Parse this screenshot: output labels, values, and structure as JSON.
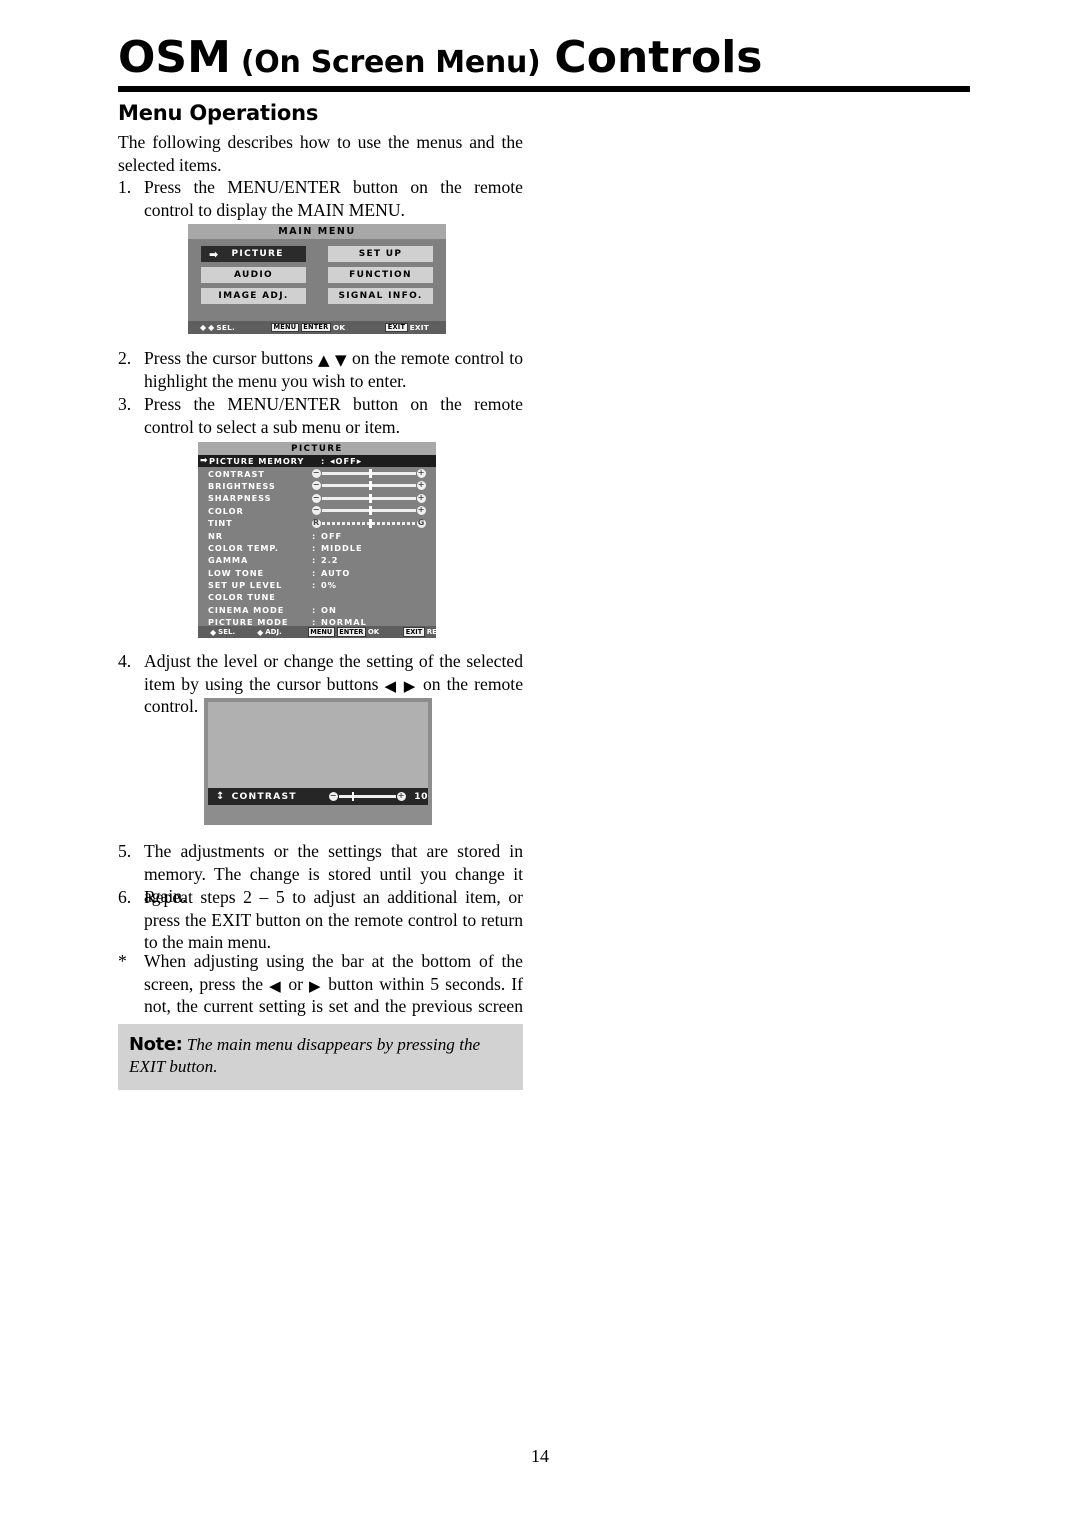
{
  "header": {
    "title_part1": "OSM",
    "title_part2": "(On Screen Menu)",
    "title_part3": "Controls",
    "section_title": "Menu Operations"
  },
  "intro": "The following describes how to use the menus and the selected items.",
  "steps": [
    {
      "marker": "1.",
      "text": "Press the MENU/ENTER button on the remote control to display the MAIN MENU."
    },
    {
      "marker": "2.",
      "text_a": "Press the cursor buttons",
      "icon_up": "▲",
      "icon_down": "▼",
      "text_b": "on the remote control to highlight the menu you wish to enter."
    },
    {
      "marker": "3.",
      "text": "Press the MENU/ENTER button on the remote control to select a sub menu or item."
    },
    {
      "marker": "4.",
      "text_a": "Adjust the level or change the setting of the selected item by using the cursor buttons",
      "icon_left": "◀",
      "icon_right": "▶",
      "text_b": "on the remote control."
    },
    {
      "marker": "5.",
      "text": "The adjustments or the settings that are stored in memory. The change is stored until you change it again."
    },
    {
      "marker": "6.",
      "text": "Repeat steps 2 – 5 to adjust an additional item, or press the EXIT button on the remote control to return to the main menu."
    }
  ],
  "footnote": {
    "marker": "*",
    "text_a": "When adjusting using the bar at the bottom of the screen, press the",
    "icon_left": "◀",
    "text_mid": "or",
    "icon_right": "▶",
    "text_b": "button within 5 seconds. If not, the current setting is set and the previous screen appears."
  },
  "note": {
    "label": "Note:",
    "text": "The main menu disappears by pressing the EXIT button."
  },
  "page_number": "14",
  "main_menu": {
    "title": "MAIN MENU",
    "selected": "PICTURE",
    "buttons": [
      {
        "label": "PICTURE",
        "selected": true
      },
      {
        "label": "SET UP",
        "selected": false
      },
      {
        "label": "AUDIO",
        "selected": false
      },
      {
        "label": "FUNCTION",
        "selected": false
      },
      {
        "label": "IMAGE ADJ.",
        "selected": false
      },
      {
        "label": "SIGNAL INFO.",
        "selected": false
      }
    ],
    "footer": {
      "sel_label": "SEL.",
      "menu_key": "MENU",
      "enter_key": "ENTER",
      "ok_label": "OK",
      "exit_key": "EXIT",
      "exit_label": "EXIT"
    }
  },
  "picture_menu": {
    "title": "PICTURE",
    "rows": [
      {
        "label": "PICTURE MEMORY",
        "type": "option",
        "colon": ":",
        "value": "OFF",
        "selected": true,
        "arrows": true
      },
      {
        "label": "CONTRAST",
        "type": "slider",
        "minus": "⊖",
        "plus": "⊕",
        "knob_pct": 50,
        "dashed": false
      },
      {
        "label": "BRIGHTNESS",
        "type": "slider",
        "minus": "⊖",
        "plus": "⊕",
        "knob_pct": 50,
        "dashed": false
      },
      {
        "label": "SHARPNESS",
        "type": "slider",
        "minus": "⊖",
        "plus": "⊕",
        "knob_pct": 50,
        "dashed": false
      },
      {
        "label": "COLOR",
        "type": "slider",
        "minus": "⊖",
        "plus": "⊕",
        "knob_pct": 50,
        "dashed": false
      },
      {
        "label": "TINT",
        "type": "slider",
        "minus": "R",
        "plus": "G",
        "knob_pct": 50,
        "dashed": true
      },
      {
        "label": "NR",
        "type": "value",
        "colon": ":",
        "value": "OFF"
      },
      {
        "label": "COLOR TEMP.",
        "type": "value",
        "colon": ":",
        "value": "MIDDLE"
      },
      {
        "label": "GAMMA",
        "type": "value",
        "colon": ":",
        "value": "2.2"
      },
      {
        "label": "LOW TONE",
        "type": "value",
        "colon": ":",
        "value": "AUTO"
      },
      {
        "label": "SET UP LEVEL",
        "type": "value",
        "colon": ":",
        "value": "0%"
      },
      {
        "label": "COLOR TUNE",
        "type": "value",
        "colon": "",
        "value": ""
      },
      {
        "label": "CINEMA MODE",
        "type": "value",
        "colon": ":",
        "value": "ON"
      },
      {
        "label": "PICTURE MODE",
        "type": "value",
        "colon": ":",
        "value": "NORMAL"
      }
    ],
    "footer": {
      "sel_label": "SEL.",
      "adj_label": "ADJ.",
      "menu_key": "MENU",
      "enter_key": "ENTER",
      "ok_label": "OK",
      "exit_key": "EXIT",
      "return_label": "RETURN"
    }
  },
  "contrast_overlay": {
    "label": "CONTRAST",
    "minus": "⊖",
    "plus": "⊕",
    "value": "10",
    "knob_pct": 22
  },
  "colors": {
    "osm_background": "#808080",
    "osm_title_bar": "#a8a8a8",
    "osm_button": "#d0d0d0",
    "osm_selected": "#2b2b2b",
    "osm_footer": "#5e5e5e",
    "note_background": "#d2d2d2"
  }
}
